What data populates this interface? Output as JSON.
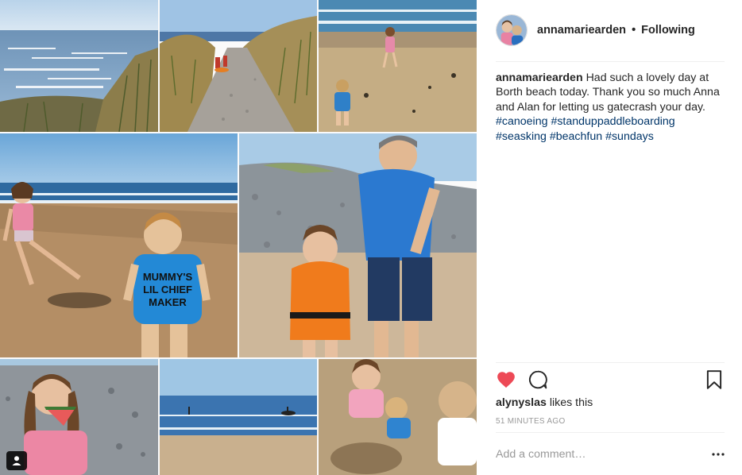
{
  "post": {
    "username": "annamariearden",
    "separator": "•",
    "follow_status": "Following"
  },
  "caption": {
    "username": "annamariearden",
    "text": "Had such a lovely day at Borth beach today. Thank you so much Anna and Alan for letting us gatecrash your day.",
    "hashtags": [
      "#canoeing",
      "#standuppaddleboarding",
      "#seasking",
      "#beachfun",
      "#sundays"
    ]
  },
  "photo_print": {
    "shirt_line1": "MUMMY'S",
    "shirt_line2": "LIL CHIEF",
    "shirt_line3": "MAKER"
  },
  "engagement": {
    "liker": "alynyslas",
    "likes_suffix": "likes this",
    "timestamp": "51 MINUTES AGO",
    "liked": true
  },
  "comment": {
    "placeholder": "Add a comment…"
  },
  "icons": {
    "heart": "heart-icon",
    "comment": "comment-icon",
    "save": "bookmark-icon",
    "more": "more-options-icon",
    "user_tag": "user-tag-icon"
  },
  "colors": {
    "like_red": "#ed4956",
    "hashtag_blue": "#003569",
    "muted_gray": "#999999"
  }
}
